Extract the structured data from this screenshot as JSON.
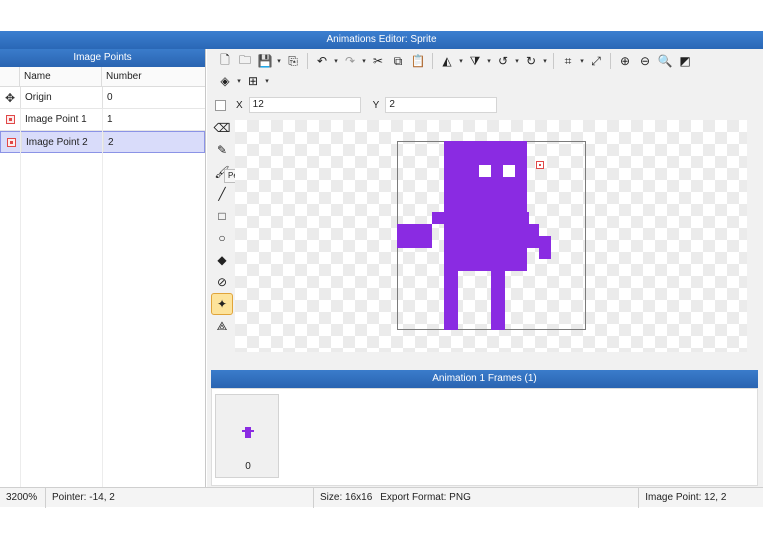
{
  "window": {
    "title": "Animations Editor: Sprite"
  },
  "left_panel": {
    "header": "Image Points",
    "columns": [
      "Name",
      "Number"
    ],
    "rows": [
      {
        "icon": "origin-icon",
        "name": "Origin",
        "number": "0"
      },
      {
        "icon": "image-point-icon",
        "name": "Image Point 1",
        "number": "1"
      },
      {
        "icon": "image-point-icon",
        "name": "Image Point 2",
        "number": "2",
        "selected": true
      }
    ]
  },
  "toolbar": {
    "row1": [
      "new-file-icon",
      "open-folder-icon",
      "save-icon",
      "export-icon",
      "undo-icon",
      "redo-icon",
      "cut-icon",
      "copy-icon",
      "paste-icon",
      "flip-horizontal-icon",
      "flip-vertical-icon",
      "rotate-ccw-icon",
      "rotate-cw-icon",
      "crop-icon",
      "resize-icon",
      "zoom-in-icon",
      "zoom-out-icon",
      "zoom-reset-icon",
      "toggle-background-icon"
    ],
    "row2": [
      "layers-icon",
      "grid-icon"
    ]
  },
  "coords": {
    "x_label": "X",
    "x_value": "12",
    "y_label": "Y",
    "y_value": "2"
  },
  "tools": [
    "eraser-icon",
    "pencil-icon",
    "brush-icon",
    "line-icon",
    "rectangle-icon",
    "ellipse-icon",
    "fill-icon",
    "eyedropper-icon",
    "image-point-tool-icon",
    "polygon-point-icon"
  ],
  "tooltip": "Pencil (N)",
  "frames": {
    "header": "Animation 1 Frames (1)",
    "items": [
      {
        "number": "0"
      }
    ]
  },
  "status": {
    "zoom": "3200%",
    "pointer": "Pointer: -14, 2",
    "size": "Size: 16x16",
    "export_format": "Export Format: PNG",
    "image_point": "Image Point: 12, 2"
  },
  "colors": {
    "sprite": "#8a2be2",
    "header_blue": "#2f6ebf",
    "selection": "#d9dcfa",
    "active_tool": "#fde39b"
  }
}
